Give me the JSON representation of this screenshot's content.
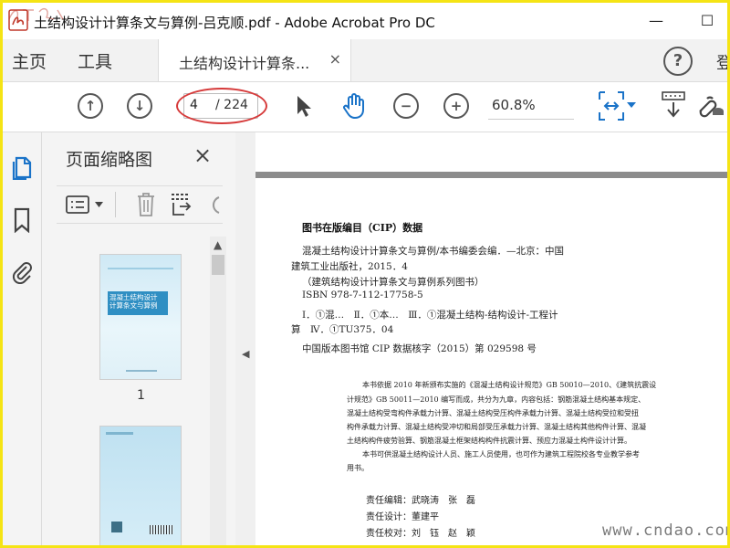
{
  "window": {
    "title": "土结构设计计算条文与算例-吕克顺.pdf - Adobe Acrobat Pro DC",
    "minimize": "—",
    "maximize": "☐"
  },
  "menu": {
    "home": "主页",
    "tools": "工具",
    "doc_tab": "土结构设计计算条...",
    "doc_tab_close": "×",
    "help": "?",
    "cut_label": "登"
  },
  "toolbar": {
    "page_current": "4",
    "page_total": "/ 224",
    "zoom": "60.8%",
    "accent": "#1a73c8",
    "highlight": "#d63a3a"
  },
  "thumbnails": {
    "title": "页面缩略图",
    "close": "×",
    "pages": [
      {
        "label": "1",
        "cover_title": "混凝土结构设计\n计算条文与算例"
      },
      {
        "label": ""
      }
    ]
  },
  "document": {
    "cip_heading": "图书在版编目（CIP）数据",
    "cip_lines": [
      "混凝土结构设计计算条文与算例/本书编委会编．—北京：中国",
      "建筑工业出版社，2015．4",
      "（建筑结构设计计算条文与算例系列图书）",
      "ISBN 978-7-112-17758-5",
      "Ⅰ．①混…　Ⅱ．①本…　Ⅲ．①混凝土结构-结构设计-工程计",
      "算　Ⅳ．①TU375．04",
      "中国版本图书馆 CIP 数据核字（2015）第 029598 号"
    ],
    "desc_lines": [
      "本书依据 2010 年新颁布实施的《混凝土结构设计规范》GB 50010—2010、《建筑抗震设",
      "计规范》GB 50011—2010 编写而成，共分为九章，内容包括：钢筋混凝土结构基本规定、",
      "混凝土结构受弯构件承载力计算、混凝土结构受压构件承载力计算、混凝土结构受拉和受扭",
      "构件承载力计算、混凝土结构受冲切和局部受压承载力计算、混凝土结构其他构件计算、混凝",
      "土结构构件疲劳验算、钢筋混凝土框架结构构件抗震计算、预应力混凝土构件设计计算。",
      "本书可供混凝土结构设计人员、施工人员使用，也可作为建筑工程院校各专业教学参考",
      "用书。"
    ],
    "credits": [
      "责任编辑：武晓涛　张　磊",
      "责任设计：董建平",
      "责任校对：刘　钰　赵　颖"
    ],
    "watermark": "www.cndao.com"
  }
}
